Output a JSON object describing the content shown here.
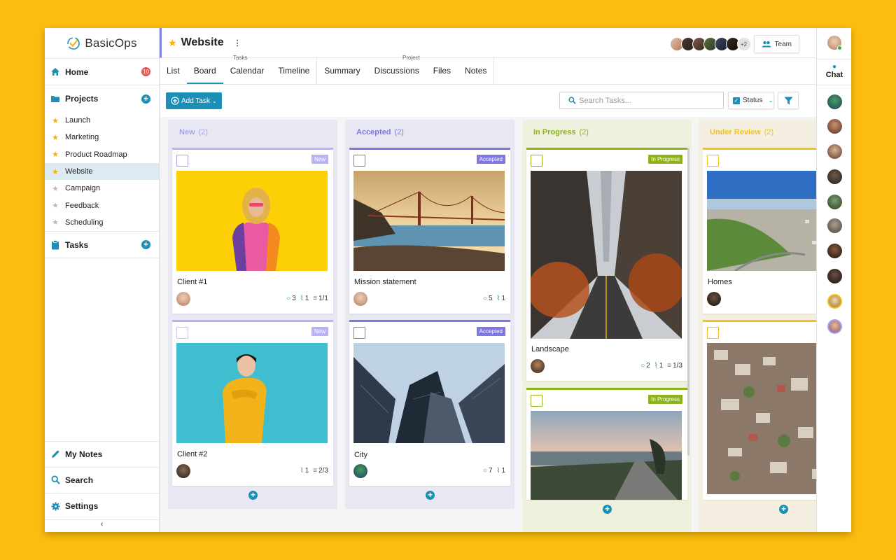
{
  "app": {
    "brand": "BasicOps"
  },
  "sidebar": {
    "home": {
      "label": "Home",
      "badge": "10"
    },
    "projects": {
      "label": "Projects"
    },
    "project_items": [
      {
        "label": "Launch",
        "starred": true
      },
      {
        "label": "Marketing",
        "starred": true
      },
      {
        "label": "Product Roadmap",
        "starred": true
      },
      {
        "label": "Website",
        "starred": true,
        "active": true
      },
      {
        "label": "Campaign",
        "starred": false
      },
      {
        "label": "Feedback",
        "starred": false
      },
      {
        "label": "Scheduling",
        "starred": false
      }
    ],
    "tasks": {
      "label": "Tasks"
    },
    "my_notes": {
      "label": "My Notes"
    },
    "search": {
      "label": "Search"
    },
    "settings": {
      "label": "Settings"
    },
    "collapse": "‹"
  },
  "header": {
    "title": "Website",
    "team_label": "Team",
    "more_members": "+2"
  },
  "tabs": {
    "group_tasks": "Tasks",
    "group_project": "Project",
    "list": "List",
    "board": "Board",
    "calendar": "Calendar",
    "timeline": "Timeline",
    "summary": "Summary",
    "discussions": "Discussions",
    "files": "Files",
    "notes": "Notes"
  },
  "toolbar": {
    "add_task": "Add Task",
    "search_placeholder": "Search Tasks...",
    "status": "Status"
  },
  "columns": [
    {
      "name": "New",
      "count": "(2)"
    },
    {
      "name": "Accepted",
      "count": "(2)"
    },
    {
      "name": "In Progress",
      "count": "(2)"
    },
    {
      "name": "Under Review",
      "count": "(2)"
    }
  ],
  "cards": {
    "client1": {
      "name": "Client #1",
      "tag": "New",
      "comments": "3",
      "attachments": "1",
      "checklist": "1/1"
    },
    "client2": {
      "name": "Client #2",
      "tag": "New",
      "attachments": "1",
      "checklist": "2/3"
    },
    "mission": {
      "name": "Mission statement",
      "tag": "Accepted",
      "comments": "5",
      "attachments": "1"
    },
    "city": {
      "name": "City",
      "tag": "Accepted",
      "comments": "7",
      "attachments": "1"
    },
    "landscape": {
      "name": "Landscape",
      "tag": "In Progress",
      "comments": "2",
      "attachments": "1",
      "checklist": "1/3"
    },
    "road": {
      "tag": "In Progress"
    },
    "homes": {
      "name": "Homes"
    }
  },
  "chat": {
    "label": "Chat"
  },
  "colors": {
    "accent": "#1B8FB6",
    "new": "#A8A3F0",
    "accepted": "#7E77E0",
    "in_progress": "#8DB21A",
    "under_review": "#F2C21B"
  }
}
